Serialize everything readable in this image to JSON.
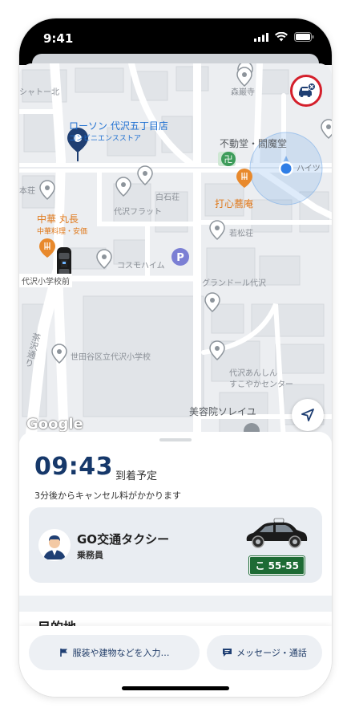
{
  "status_bar": {
    "time": "9:41"
  },
  "map": {
    "pois": {
      "lawson": "ローソン 代沢五丁目店",
      "lawson_sub": "コンビニエンスストア",
      "shrine": "森巌寺",
      "fudodo": "不動堂・閻魔堂",
      "shiraishi": "白石荘",
      "restaurant": "打心蕎庵",
      "chuka": "中華 丸長",
      "chuka_sub": "中華料理・安価",
      "flat": "代沢フラット",
      "cosmo": "コスモハイム",
      "wakamatsu": "若松荘",
      "grandor": "グランドール代沢",
      "school": "世田谷区立代沢小学校",
      "anshin": "代沢あんしん",
      "anshin2": "すこやかセンター",
      "salon": "美容院ソレイユ",
      "sharetown": "シャトー北",
      "honso": "本荘",
      "school_front": "代沢小学校前",
      "road": "茶沢通り",
      "haitsu": "ハイツ"
    },
    "brand": "Google",
    "icons": [
      "car-cancel-icon",
      "navigation-arrow-icon"
    ]
  },
  "trip": {
    "eta_time": "09:43",
    "eta_label": "到着予定",
    "cancel_notice": "3分後からキャンセル料がかかります"
  },
  "driver": {
    "company": "GO交通タクシー",
    "role": "乗務員",
    "plate": "こ 55-55"
  },
  "destination": {
    "label": "目的地"
  },
  "actions": {
    "landmark_button": "服装や建物などを入力…",
    "message_button": "メッセージ・通話"
  },
  "colors": {
    "eta": "#16386a",
    "accent": "#1e6fd1",
    "plate": "#1e6b35",
    "alert": "#d41f2b"
  }
}
